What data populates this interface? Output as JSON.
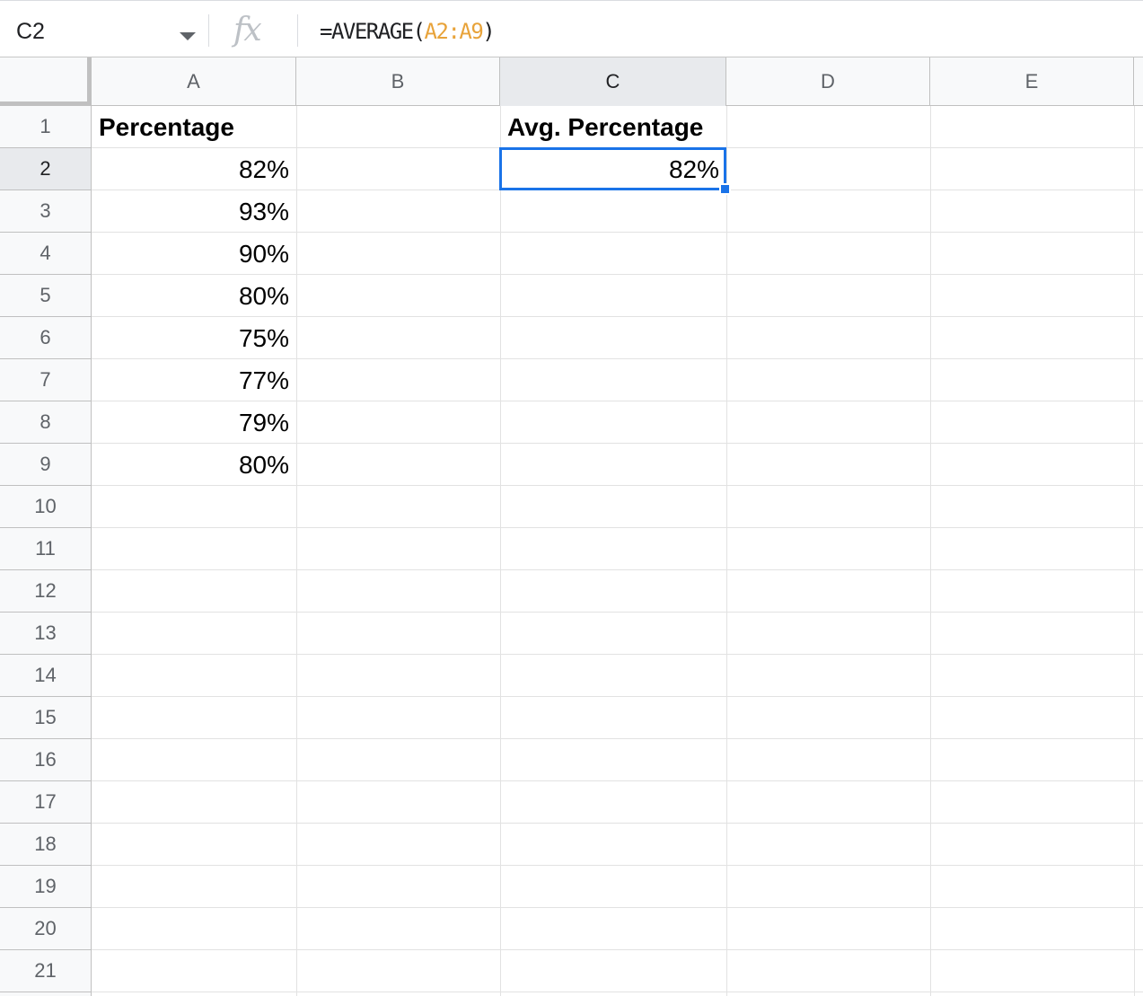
{
  "formula_bar": {
    "name_box": "C2",
    "fx_icon": "fx-icon",
    "formula_prefix": "=AVERAGE(",
    "formula_ref": "A2:A9",
    "formula_suffix": ")"
  },
  "columns": [
    "A",
    "B",
    "C",
    "D",
    "E"
  ],
  "selected_column": "C",
  "rows": [
    "1",
    "2",
    "3",
    "4",
    "5",
    "6",
    "7",
    "8",
    "9",
    "10",
    "11",
    "12",
    "13",
    "14",
    "15",
    "16",
    "17",
    "18",
    "19",
    "20",
    "21"
  ],
  "selected_row": "2",
  "cells": {
    "A1": "Percentage",
    "A2": "82%",
    "A3": "93%",
    "A4": "90%",
    "A5": "80%",
    "A6": "75%",
    "A7": "77%",
    "A8": "79%",
    "A9": "80%",
    "C1": "Avg. Percentage",
    "C2": "82%"
  },
  "colors": {
    "selection": "#1a73e8",
    "formula_reference": "#e8a33a"
  }
}
